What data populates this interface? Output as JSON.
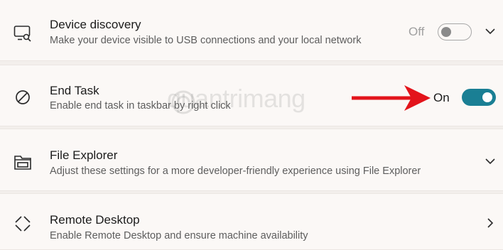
{
  "settings": [
    {
      "title": "Device discovery",
      "description": "Make your device visible to USB connections and your local network",
      "state": "Off",
      "icon": "device-discovery-icon"
    },
    {
      "title": "End Task",
      "description": "Enable end task in taskbar by right click",
      "state": "On",
      "icon": "end-task-icon"
    },
    {
      "title": "File Explorer",
      "description": "Adjust these settings for a more developer-friendly experience using File Explorer",
      "icon": "folder-icon"
    },
    {
      "title": "Remote Desktop",
      "description": "Enable Remote Desktop and ensure machine availability",
      "icon": "remote-desktop-icon"
    }
  ],
  "watermark": "quantrimang",
  "colors": {
    "accent": "#1a7f94",
    "annotation_arrow": "#e3141b"
  }
}
